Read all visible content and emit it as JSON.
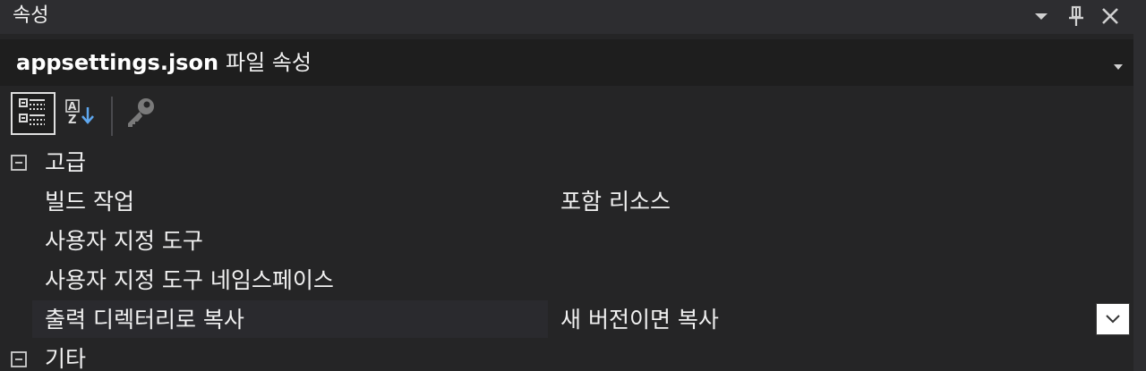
{
  "window": {
    "title": "속성",
    "icons": [
      "chevron-down-icon",
      "pin-icon",
      "close-icon"
    ]
  },
  "selector": {
    "object_name": "appsettings.json",
    "object_type": "파일 속성"
  },
  "toolbar": {
    "icons": [
      "categorized-icon",
      "alphabetical-sort-icon",
      "property-pages-icon"
    ],
    "active": "categorized-icon"
  },
  "grid": {
    "categories": [
      {
        "label": "고급",
        "expanded": true,
        "properties": [
          {
            "name": "빌드 작업",
            "value": "포함 리소스"
          },
          {
            "name": "사용자 지정 도구",
            "value": ""
          },
          {
            "name": "사용자 지정 도구 네임스페이스",
            "value": ""
          },
          {
            "name": "출력 디렉터리로 복사",
            "value": "새 버전이면 복사",
            "selected": true
          }
        ]
      },
      {
        "label": "기타",
        "expanded": true,
        "properties": []
      }
    ]
  },
  "colors": {
    "background": "#252526",
    "titlebar": "#2d2d30",
    "selector_bg": "#1e1e1e",
    "text": "#f1f1f1"
  }
}
